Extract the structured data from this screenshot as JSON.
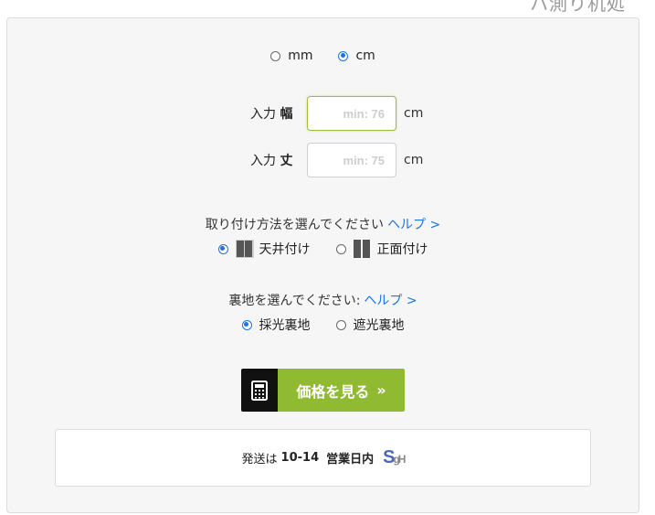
{
  "header": {
    "faded_title": "ハ測り机処"
  },
  "units": {
    "mm_label": "mm",
    "cm_label": "cm",
    "selected": "cm"
  },
  "dimensions": {
    "width": {
      "label_prefix": "入力",
      "label_bold": "幅",
      "placeholder": "min: 76",
      "unit": "cm"
    },
    "height": {
      "label_prefix": "入力",
      "label_bold": "丈",
      "placeholder": "min: 75",
      "unit": "cm"
    }
  },
  "mounting": {
    "question": "取り付け方法を選んでください",
    "help": "ヘルプ >",
    "options": [
      {
        "label": "天井付け",
        "selected": true
      },
      {
        "label": "正面付け",
        "selected": false
      }
    ]
  },
  "lining": {
    "question": "裏地を選んでください:",
    "help": "ヘルプ >",
    "options": [
      {
        "label": "採光裏地",
        "selected": true
      },
      {
        "label": "遮光裏地",
        "selected": false
      }
    ]
  },
  "price_button": {
    "label": "価格を見る",
    "arrow": "»",
    "icon": "calculator-icon"
  },
  "shipping": {
    "prefix": "発送は",
    "days": "10-14",
    "suffix": "営業日内",
    "logo_text": "S",
    "logo_small": "gH"
  },
  "colors": {
    "accent_green": "#8fba32",
    "link_blue": "#1a73e8"
  }
}
